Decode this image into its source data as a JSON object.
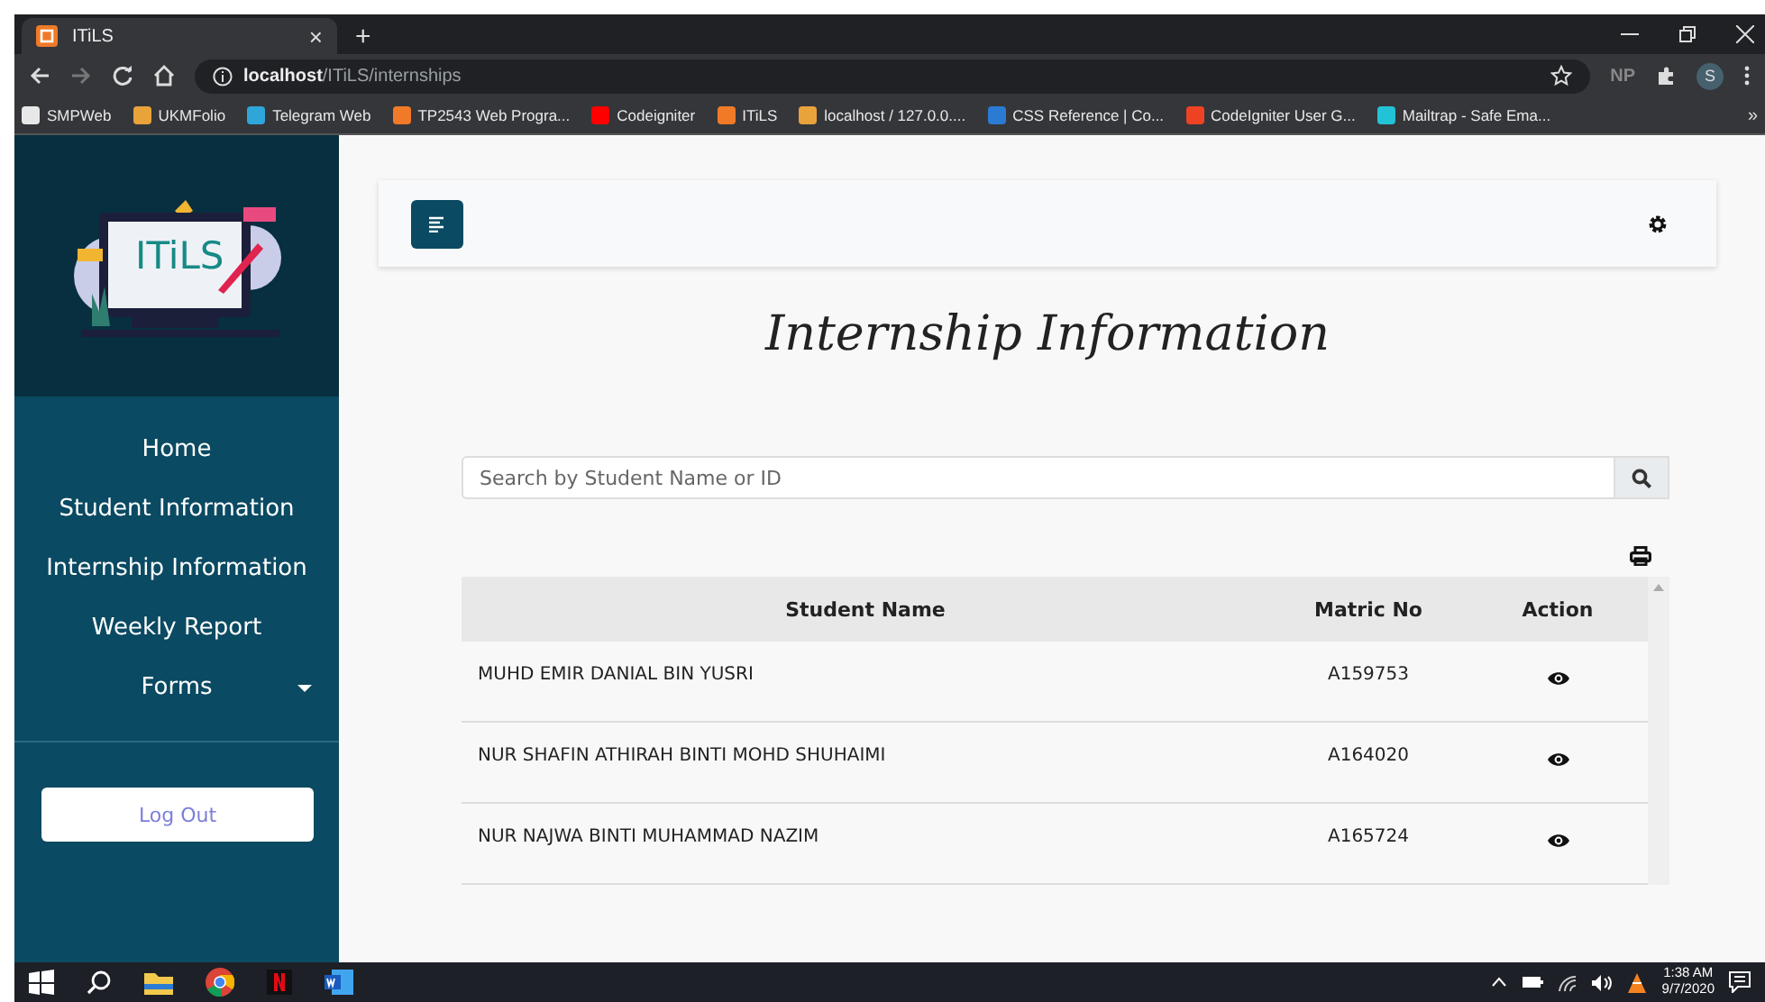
{
  "browser": {
    "tab": {
      "title": "ITiLS",
      "close": "×"
    },
    "new_tab": "+",
    "address": {
      "host": "localhost",
      "path": "/ITiLS/internships"
    },
    "profile": "S",
    "extension_text": "NP",
    "bookmarks": [
      {
        "label": "SMPWeb",
        "color": "#e8e8e8"
      },
      {
        "label": "UKMFolio",
        "color": "#e8a33b"
      },
      {
        "label": "Telegram Web",
        "color": "#2ea6da"
      },
      {
        "label": "TP2543 Web Progra...",
        "color": "#f07a28"
      },
      {
        "label": "Codeigniter",
        "color": "#ff0000"
      },
      {
        "label": "ITiLS",
        "color": "#f07a28"
      },
      {
        "label": "localhost / 127.0.0....",
        "color": "#e8a33b"
      },
      {
        "label": "CSS Reference | Co...",
        "color": "#2a7bd4"
      },
      {
        "label": "CodeIgniter User G...",
        "color": "#ee4323"
      },
      {
        "label": "Mailtrap - Safe Ema...",
        "color": "#22c3d6"
      }
    ],
    "more": "»"
  },
  "sidebar": {
    "logo_text": "ITiLS",
    "items": [
      {
        "label": "Home",
        "kind": "link"
      },
      {
        "label": "Student Information",
        "kind": "link"
      },
      {
        "label": "Internship Information",
        "kind": "link"
      },
      {
        "label": "Weekly Report",
        "kind": "link"
      },
      {
        "label": "Forms",
        "kind": "dropdown"
      }
    ],
    "logout": "Log Out"
  },
  "page": {
    "title": "Internship Information",
    "search": {
      "placeholder": "Search by Student Name or ID"
    },
    "table": {
      "columns": [
        "Student Name",
        "Matric No",
        "Action"
      ],
      "rows": [
        {
          "name": "MUHD EMIR DANIAL BIN YUSRI",
          "matric": "A159753"
        },
        {
          "name": "NUR SHAFIN ATHIRAH BINTI MOHD SHUHAIMI",
          "matric": "A164020"
        },
        {
          "name": "NUR NAJWA BINTI MUHAMMAD NAZIM",
          "matric": "A165724"
        }
      ]
    }
  },
  "taskbar": {
    "time": "1:38 AM",
    "date": "9/7/2020"
  }
}
